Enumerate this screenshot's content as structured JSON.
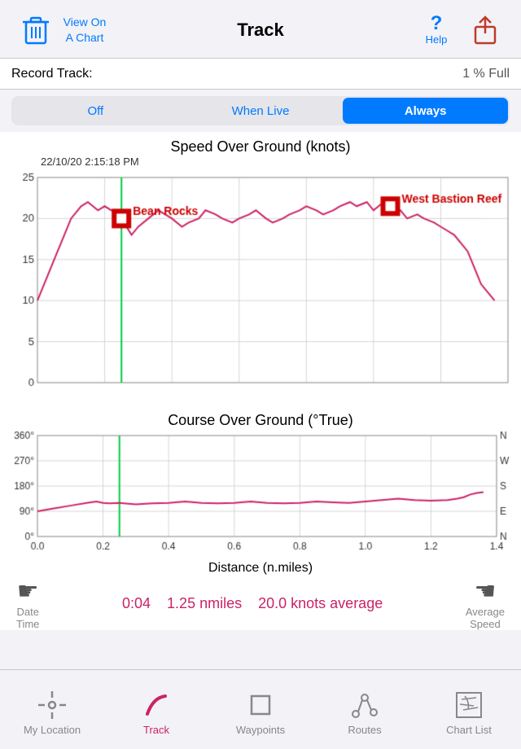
{
  "header": {
    "title": "Track",
    "view_on_chart": "View On\nA Chart",
    "help": "?",
    "help_label": "Help"
  },
  "record_track": {
    "label": "Record Track:",
    "status": "1 % Full"
  },
  "segment": {
    "options": [
      "Off",
      "When Live",
      "Always"
    ],
    "active": 2
  },
  "chart1": {
    "title": "Speed Over Ground (knots)",
    "subtitle": "22/10/20  2:15:18 PM",
    "waypoints": [
      {
        "label": "Bean Rocks",
        "x": 0.25,
        "y_knots": 20
      },
      {
        "label": "West Bastion Reef",
        "x": 1.05,
        "y_knots": 21
      }
    ],
    "y_max": 25,
    "y_min": 0,
    "y_ticks": [
      0,
      5,
      10,
      15,
      20,
      25
    ]
  },
  "chart2": {
    "title": "Course Over Ground (°True)",
    "y_labels_left": [
      "0°",
      "90°",
      "180°",
      "270°",
      "360°"
    ],
    "y_labels_right": [
      "N",
      "E",
      "S",
      "W",
      "N"
    ],
    "x_max": 1.4
  },
  "x_axis": {
    "label": "Distance (n.miles)",
    "ticks": [
      0,
      0.2,
      0.4,
      0.6,
      0.8,
      1.0,
      1.2,
      1.4
    ]
  },
  "stats": {
    "left_icon": "☛",
    "right_icon": "☛",
    "left_labels": [
      "Date",
      "Time"
    ],
    "right_labels": [
      "Average",
      "Speed"
    ],
    "values": [
      "0:04",
      "1.25 nmiles",
      "20.0 knots average"
    ]
  },
  "tabs": [
    {
      "label": "My Location",
      "icon": "my-location",
      "active": false
    },
    {
      "label": "Track",
      "icon": "track",
      "active": true
    },
    {
      "label": "Waypoints",
      "icon": "waypoints",
      "active": false
    },
    {
      "label": "Routes",
      "icon": "routes",
      "active": false
    },
    {
      "label": "Chart List",
      "icon": "chart-list",
      "active": false
    }
  ]
}
